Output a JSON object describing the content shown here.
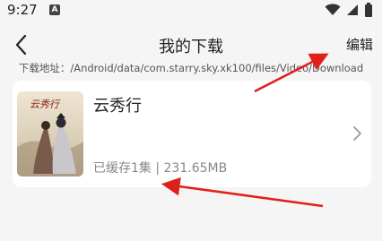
{
  "status_bar": {
    "time": "9:27",
    "notification_glyph": "A",
    "icons": [
      "wifi-icon",
      "signal-icon",
      "battery-icon"
    ]
  },
  "nav": {
    "title": "我的下载",
    "edit_label": "编辑",
    "back_icon": "chevron-left-icon"
  },
  "download_path": "下载地址：/Android/data/com.starry.sky.xk100/files/Video/Download",
  "items": [
    {
      "title": "云秀行",
      "cache_info": "已缓存1集 | 231.65MB",
      "poster_text": "云秀行",
      "chevron_icon": "chevron-right-icon"
    }
  ],
  "colors": {
    "background": "#f5f5f5",
    "card": "#ffffff",
    "annotation_arrow": "#e0201a"
  }
}
